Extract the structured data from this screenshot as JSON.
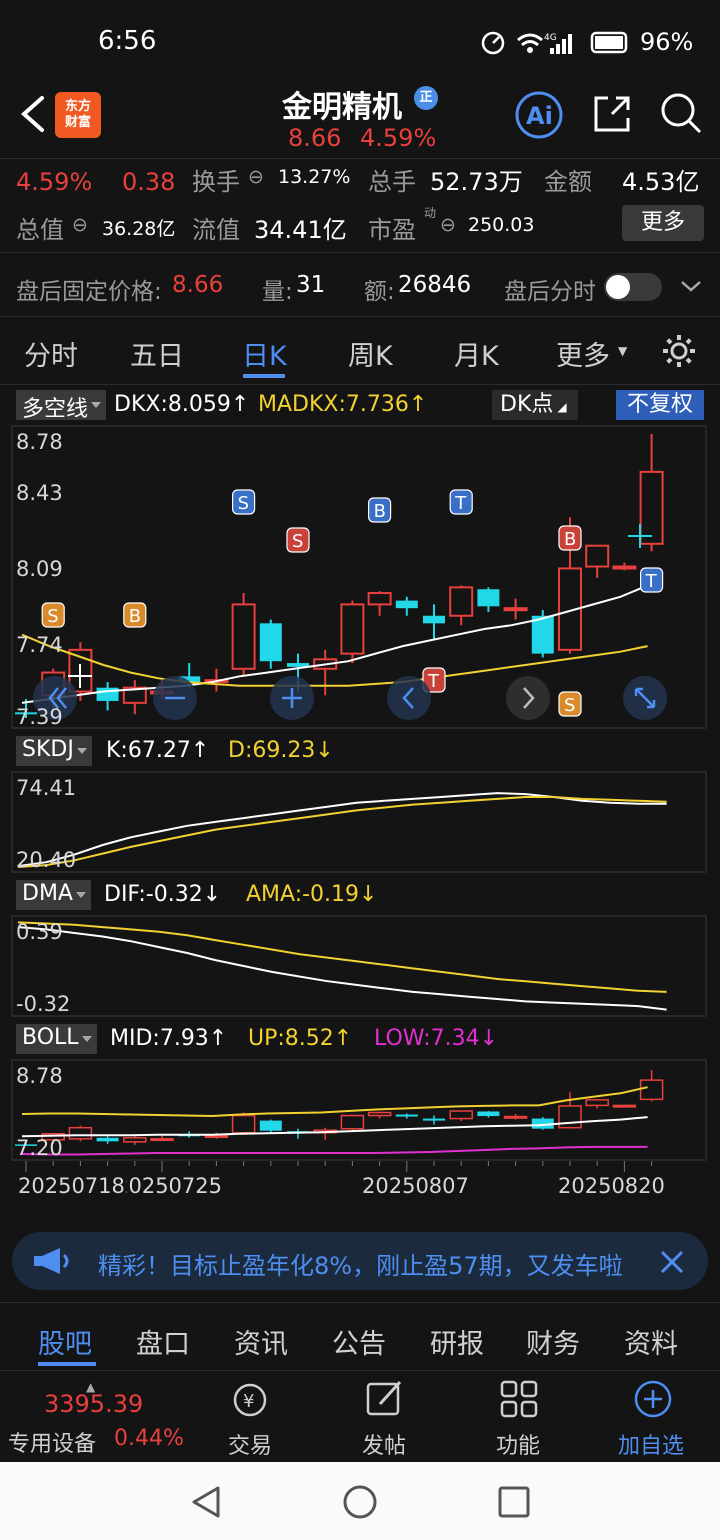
{
  "status": {
    "time": "6:56",
    "battery": "96%"
  },
  "header": {
    "logo_line1": "东方",
    "logo_line2": "财富",
    "title": "金明精机",
    "badge": "正",
    "price": "8.66",
    "pct": "4.59%"
  },
  "quote": {
    "chg_pct": "4.59%",
    "chg": "0.38",
    "turnover_label": "换手",
    "turnover": "13.27%",
    "volume_label": "总手",
    "volume": "52.73万",
    "amount_label": "金额",
    "amount": "4.53亿",
    "mktcap_label": "总值",
    "mktcap": "36.28亿",
    "float_label": "流值",
    "float": "34.41亿",
    "pe_label": "市盈",
    "pe_sup": "动",
    "pe": "250.03",
    "more": "更多"
  },
  "after_hours": {
    "price_label": "盘后固定价格:",
    "price": "8.66",
    "vol_label": "量:",
    "vol": "31",
    "amt_label": "额:",
    "amt": "26846",
    "timeshare_label": "盘后分时",
    "toggle_on": false
  },
  "tabs": [
    "分时",
    "五日",
    "日K",
    "周K",
    "月K",
    "更多"
  ],
  "active_tab": 2,
  "kchart": {
    "indicator": "多空线",
    "dkx": "DKX:8.059↑",
    "madkx": "MADKX:7.736↑",
    "dk_point": "DK点",
    "adjust": "不复权",
    "y_labels": [
      "8.78",
      "8.43",
      "8.09",
      "7.74",
      "7.39"
    ],
    "markers": [
      "S",
      "B",
      "S",
      "S",
      "B",
      "T",
      "T",
      "B",
      "S",
      "T"
    ]
  },
  "skdj": {
    "name": "SKDJ",
    "k": "K:67.27↑",
    "d": "D:69.23↓",
    "y_labels": [
      "74.41",
      "20.40"
    ]
  },
  "dma": {
    "name": "DMA",
    "dif": "DIF:-0.32↓",
    "ama": "AMA:-0.19↓",
    "y_labels": [
      "0.39",
      "-0.32"
    ]
  },
  "boll": {
    "name": "BOLL",
    "mid": "MID:7.93↑",
    "up": "UP:8.52↑",
    "low": "LOW:7.34↓",
    "y_labels": [
      "8.78",
      "7.20"
    ]
  },
  "x_dates": [
    "20250718",
    "20250725",
    "20250807",
    "20250820"
  ],
  "banner": {
    "text": "精彩！目标止盈年化8%，刚止盈57期，又发车啦"
  },
  "bottom_tabs": [
    "股吧",
    "盘口",
    "资讯",
    "公告",
    "研报",
    "财务",
    "资料"
  ],
  "bottom_bar": {
    "index_value": "3395.39",
    "index_name": "专用设备",
    "index_pct": "0.44%",
    "trade": "交易",
    "post": "发帖",
    "features": "功能",
    "add": "加自选"
  },
  "colors": {
    "up": "#e8403c",
    "down": "#22d8e8",
    "accent": "#4d8ef0",
    "yellow": "#f2d230",
    "magenta": "#e030d0"
  }
}
